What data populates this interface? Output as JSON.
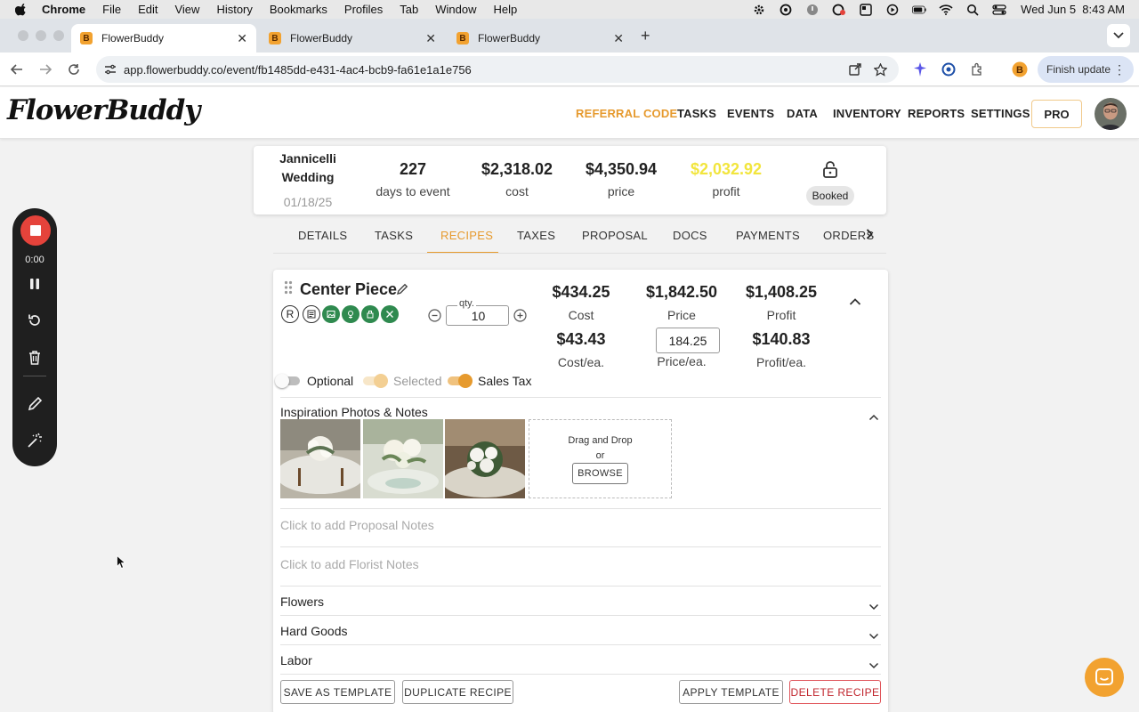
{
  "menubar": {
    "app_name": "Chrome",
    "items": [
      "File",
      "Edit",
      "View",
      "History",
      "Bookmarks",
      "Profiles",
      "Tab",
      "Window",
      "Help"
    ],
    "datetime": "Wed Jun 5  8:43 AM"
  },
  "browser": {
    "tabs": [
      {
        "title": "FlowerBuddy",
        "active": true
      },
      {
        "title": "FlowerBuddy",
        "active": false
      },
      {
        "title": "FlowerBuddy",
        "active": false
      }
    ],
    "url": "app.flowerbuddy.co/event/fb1485dd-e431-4ac4-bcb9-fa61e1a1e756",
    "finish_update": "Finish update"
  },
  "header": {
    "logo": "FlowerBuddy",
    "nav": [
      "REFERRAL CODE",
      "TASKS",
      "EVENTS",
      "DATA",
      "INVENTORY",
      "REPORTS",
      "SETTINGS"
    ],
    "pro": "PRO"
  },
  "recorder": {
    "time": "0:00"
  },
  "event": {
    "name": "Jannicelli Wedding",
    "date": "01/18/25",
    "days_to_event": "227",
    "days_label": "days to event",
    "cost": "$2,318.02",
    "cost_label": "cost",
    "price": "$4,350.94",
    "price_label": "price",
    "profit": "$2,032.92",
    "profit_label": "profit",
    "status": "Booked"
  },
  "tabs": [
    "DETAILS",
    "TASKS",
    "RECIPES",
    "TAXES",
    "PROPOSAL",
    "DOCS",
    "PAYMENTS",
    "ORDERS"
  ],
  "active_tab": "RECIPES",
  "recipe": {
    "title": "Center Piece",
    "badge_letter": "R",
    "qty_label": "qty.",
    "qty": "10",
    "cost": "$434.25",
    "cost_label": "Cost",
    "price": "$1,842.50",
    "price_label": "Price",
    "profit": "$1,408.25",
    "profit_label": "Profit",
    "cost_each": "$43.43",
    "cost_each_label": "Cost/ea.",
    "price_each": "184.25",
    "price_each_label": "Price/ea.",
    "profit_each": "$140.83",
    "profit_each_label": "Profit/ea.",
    "toggles": [
      {
        "label": "Optional",
        "on": false
      },
      {
        "label": "Selected",
        "on": true,
        "disabled": true
      },
      {
        "label": "Sales Tax",
        "on": true
      }
    ],
    "inspiration_label": "Inspiration Photos & Notes",
    "drop_text": "Drag and Drop",
    "or_text": "or",
    "browse": "BROWSE",
    "proposal_notes_placeholder": "Click to add Proposal Notes",
    "florist_notes_placeholder": "Click to add Florist Notes",
    "sections": [
      "Flowers",
      "Hard Goods",
      "Labor"
    ],
    "buttons": {
      "save_template": "SAVE AS TEMPLATE",
      "duplicate": "DUPLICATE RECIPE",
      "apply_template": "APPLY TEMPLATE",
      "delete": "DELETE RECIPE"
    }
  },
  "colors": {
    "accent": "#e69a2e",
    "profit_highlight": "#f2e53d",
    "danger": "#c0242c",
    "recipe_icon_green": "#2f8a4f"
  }
}
